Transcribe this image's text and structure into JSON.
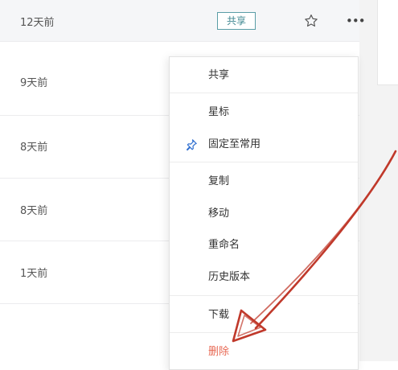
{
  "file_rows": [
    {
      "modified": "12天前",
      "share_badge": "共享"
    },
    {
      "modified": "9天前"
    },
    {
      "modified": "8天前"
    },
    {
      "modified": "8天前"
    },
    {
      "modified": "1天前"
    }
  ],
  "context_menu": {
    "share": "共享",
    "star": "星标",
    "pin": "固定至常用",
    "copy": "复制",
    "move": "移动",
    "rename": "重命名",
    "history": "历史版本",
    "download": "下载",
    "delete": "删除"
  },
  "icons": {
    "star": "star-outline-icon",
    "more": "more-horizontal-icon",
    "pin": "pin-icon"
  },
  "colors": {
    "accent": "#3f8791",
    "pin_icon": "#2f6fd0",
    "danger": "#e86a55",
    "annotation_arrow": "#c0392b",
    "row_highlight": "#f5f6f8"
  }
}
